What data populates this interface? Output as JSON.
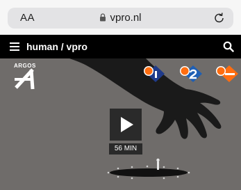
{
  "browser": {
    "text_size_label": "AA",
    "url": "vpro.nl"
  },
  "site": {
    "title": "human / vpro"
  },
  "video": {
    "program_label": "ARGOS",
    "duration": "56 MIN",
    "channel_badges": [
      {
        "name": "npo-radio-1",
        "color": "#1f3a8a"
      },
      {
        "name": "npo-2",
        "color": "#1e5fb4"
      },
      {
        "name": "npo-start",
        "color": "#ff6d10"
      }
    ]
  },
  "colors": {
    "site_header_bg": "#000000",
    "video_bg": "#6f6c6a",
    "npo_orange": "#ff6d10"
  }
}
